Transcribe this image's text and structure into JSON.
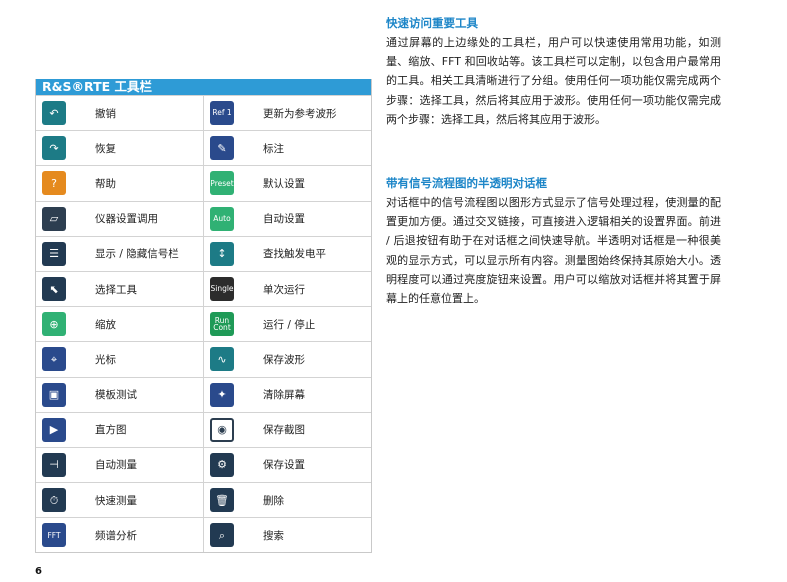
{
  "toolbar_table": {
    "header": "R&S®RTE 工具栏",
    "rows": [
      [
        {
          "label": "撤销",
          "icon": "undo-icon",
          "glyph": "↶"
        },
        {
          "label": "更新为参考波形",
          "icon": "ref1-icon",
          "glyph": "Ref 1"
        }
      ],
      [
        {
          "label": "恢复",
          "icon": "redo-icon",
          "glyph": "↷"
        },
        {
          "label": "标注",
          "icon": "annotation-icon",
          "glyph": "✎"
        }
      ],
      [
        {
          "label": "帮助",
          "icon": "help-icon",
          "glyph": "?"
        },
        {
          "label": "默认设置",
          "icon": "preset-icon",
          "glyph": "Preset"
        }
      ],
      [
        {
          "label": "仪器设置调用",
          "icon": "folder-open-icon",
          "glyph": "▱"
        },
        {
          "label": "自动设置",
          "icon": "auto-icon",
          "glyph": "Auto"
        }
      ],
      [
        {
          "label": "显示 / 隐藏信号栏",
          "icon": "signal-bar-icon",
          "glyph": "☰"
        },
        {
          "label": "查找触发电平",
          "icon": "find-trigger-level-icon",
          "glyph": "↕"
        }
      ],
      [
        {
          "label": "选择工具",
          "icon": "select-tool-icon",
          "glyph": "⬉"
        },
        {
          "label": "单次运行",
          "icon": "single-icon",
          "glyph": "Single"
        }
      ],
      [
        {
          "label": "缩放",
          "icon": "zoom-icon",
          "glyph": "⊕"
        },
        {
          "label": "运行 / 停止",
          "icon": "run-cont-icon",
          "glyph": "Run Cont"
        }
      ],
      [
        {
          "label": "光标",
          "icon": "cursor-icon",
          "glyph": "⌖"
        },
        {
          "label": "保存波形",
          "icon": "save-waveform-icon",
          "glyph": "∿"
        }
      ],
      [
        {
          "label": "模板测试",
          "icon": "mask-test-icon",
          "glyph": "▣"
        },
        {
          "label": "清除屏幕",
          "icon": "clear-screen-icon",
          "glyph": "✦"
        }
      ],
      [
        {
          "label": "直方图",
          "icon": "histogram-icon",
          "glyph": "▶"
        },
        {
          "label": "保存截图",
          "icon": "screenshot-camera-icon",
          "glyph": "◉"
        }
      ],
      [
        {
          "label": "自动测量",
          "icon": "auto-measure-icon",
          "glyph": "⊣"
        },
        {
          "label": "保存设置",
          "icon": "save-settings-icon",
          "glyph": "⚙"
        }
      ],
      [
        {
          "label": "快速测量",
          "icon": "quick-measure-icon",
          "glyph": "⏱"
        },
        {
          "label": "删除",
          "icon": "delete-trash-icon",
          "glyph": "🗑"
        }
      ],
      [
        {
          "label": "频谱分析",
          "icon": "spectrum-fft-icon",
          "glyph": "FFT"
        },
        {
          "label": "搜索",
          "icon": "search-binoculars-icon",
          "glyph": "⌕"
        }
      ]
    ]
  },
  "section1": {
    "title": "快速访问重要工具",
    "body": "通过屏幕的上边缘处的工具栏，用户可以快速使用常用功能，如测量、缩放、FFT 和回收站等。该工具栏可以定制，以包含用户最常用的工具。相关工具清晰进行了分组。使用任何一项功能仅需完成两个步骤：选择工具，然后将其应用于波形。使用任何一项功能仅需完成两个步骤：选择工具，然后将其应用于波形。"
  },
  "section2": {
    "title": "带有信号流程图的半透明对话框",
    "body": "对话框中的信号流程图以图形方式显示了信号处理过程，使测量的配置更加方便。通过交叉链接，可直接进入逻辑相关的设置界面。前进 / 后退按钮有助于在对话框之间快速导航。半透明对话框是一种很美观的显示方式，可以显示所有内容。测量图始终保持其原始大小。透明程度可以通过亮度旋钮来设置。用户可以缩放对话框并将其置于屏幕上的任意位置上。"
  },
  "page_number": "6"
}
